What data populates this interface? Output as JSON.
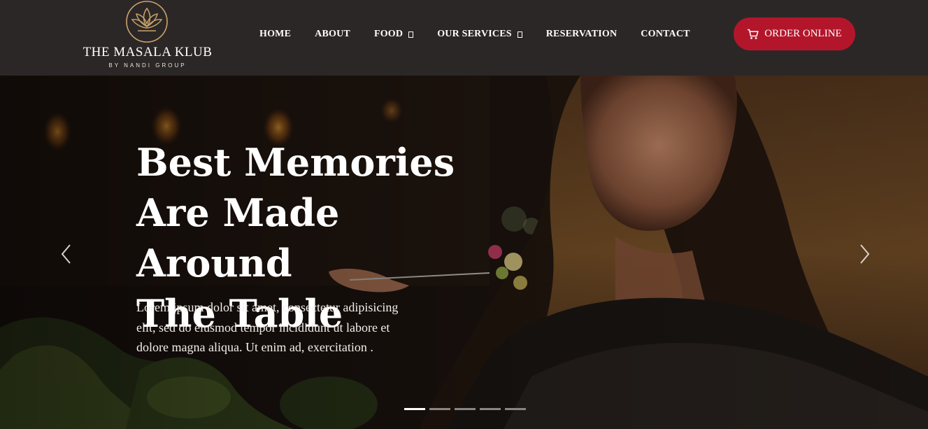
{
  "brand": {
    "name": "THE MASALA KLUB",
    "tagline": "BY NANDI GROUP",
    "logo_icon": "lotus-icon",
    "accent_gold": "#c9a46a"
  },
  "nav": {
    "items": [
      {
        "label": "HOME",
        "has_dropdown": false
      },
      {
        "label": "ABOUT",
        "has_dropdown": false
      },
      {
        "label": "FOOD",
        "has_dropdown": true
      },
      {
        "label": "OUR SERVICES",
        "has_dropdown": true
      },
      {
        "label": "RESERVATION",
        "has_dropdown": false
      },
      {
        "label": "CONTACT",
        "has_dropdown": false
      }
    ]
  },
  "cta": {
    "label": "ORDER ONLINE",
    "icon": "cart-icon",
    "color": "#b3162b"
  },
  "hero": {
    "title_line1": "Best Memories",
    "title_line2": "Are Made Around",
    "title_line3": "The Table",
    "body": "Lorem ipsum dolor sit amet, consectetur adipisicing elit, sed do eiusmod tempor incididunt ut labore et dolore magna aliqua. Ut enim ad, exercitation .",
    "prev_icon": "chevron-left-icon",
    "next_icon": "chevron-right-icon"
  },
  "slider": {
    "slide_count": 5,
    "active_index": 0
  },
  "colors": {
    "header_bg": "#2c2727",
    "text": "#ffffff"
  }
}
